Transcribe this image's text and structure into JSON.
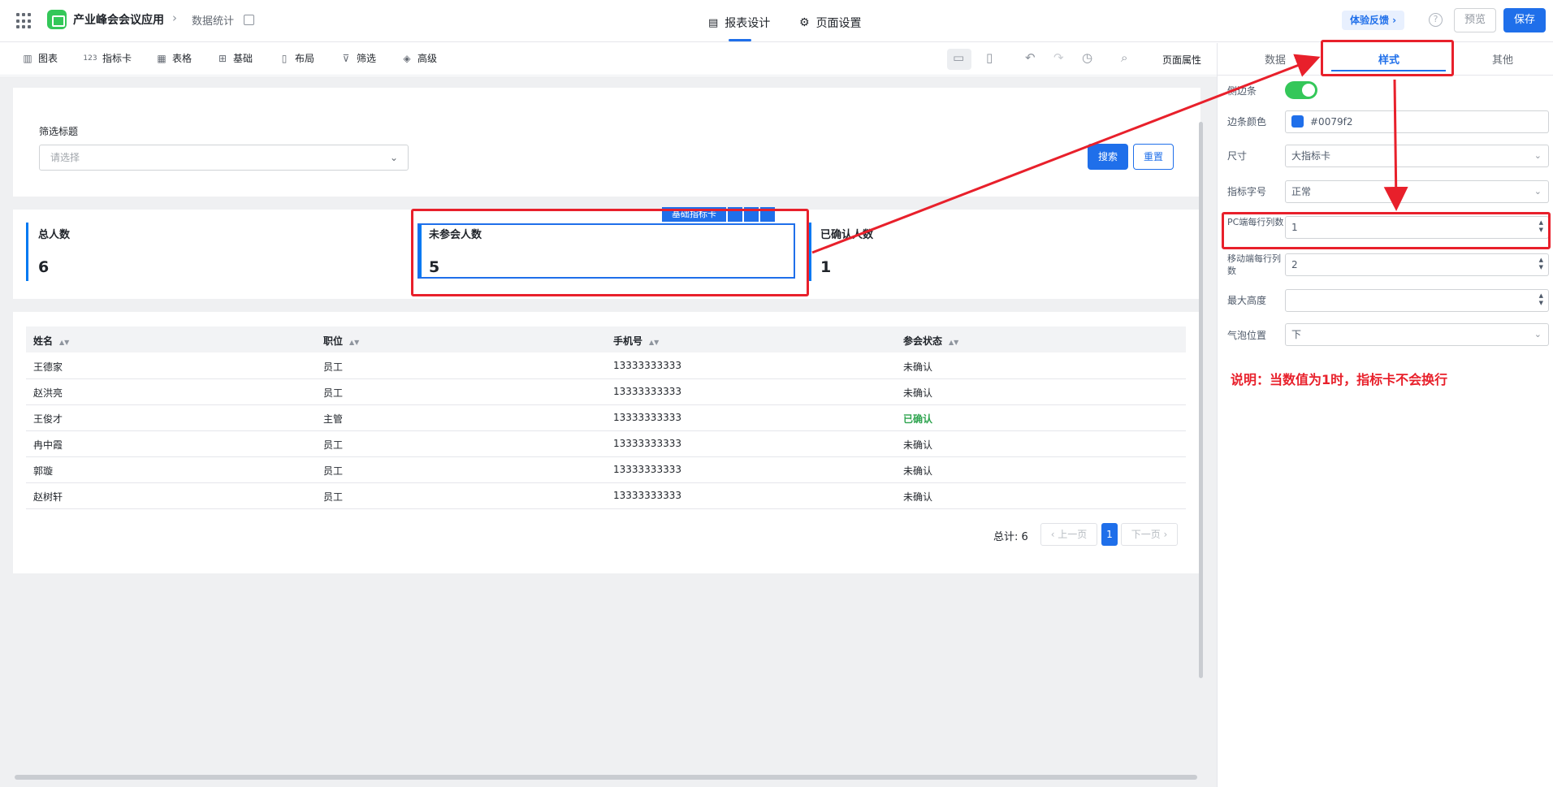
{
  "header": {
    "app_name": "产业峰会会议应用",
    "breadcrumb_sep": "›",
    "breadcrumb_page": "数据统计",
    "tabs": [
      {
        "label": "报表设计",
        "icon": "report-icon"
      },
      {
        "label": "页面设置",
        "icon": "gear-icon"
      }
    ],
    "feedback_label": "体验反馈 ›",
    "help_symbol": "?",
    "preview_label": "预览",
    "save_label": "保存"
  },
  "toolbar": {
    "items": [
      {
        "label": "图表",
        "icon": "bar-chart-icon"
      },
      {
        "label": "指标卡",
        "icon": "123-icon"
      },
      {
        "label": "表格",
        "icon": "table-icon"
      },
      {
        "label": "基础",
        "icon": "grid-icon"
      },
      {
        "label": "布局",
        "icon": "layout-icon"
      },
      {
        "label": "筛选",
        "icon": "filter-icon"
      },
      {
        "label": "高级",
        "icon": "layers-icon"
      }
    ],
    "page_props_label": "页面属性"
  },
  "filter": {
    "label": "筛选标题",
    "placeholder": "请选择",
    "search_label": "搜索",
    "reset_label": "重置"
  },
  "metrics": [
    {
      "title": "总人数",
      "value": "6"
    },
    {
      "title": "未参会人数",
      "value": "5"
    },
    {
      "title": "已确认人数",
      "value": "1"
    }
  ],
  "card_toolbar_label": "基础指标卡",
  "table": {
    "columns": [
      "姓名",
      "职位",
      "手机号",
      "参会状态"
    ],
    "rows": [
      [
        "王德家",
        "员工",
        "13333333333",
        "未确认"
      ],
      [
        "赵洪亮",
        "员工",
        "13333333333",
        "未确认"
      ],
      [
        "王俊才",
        "主管",
        "13333333333",
        "已确认"
      ],
      [
        "冉中霞",
        "员工",
        "13333333333",
        "未确认"
      ],
      [
        "郭璇",
        "员工",
        "13333333333",
        "未确认"
      ],
      [
        "赵树轩",
        "员工",
        "13333333333",
        "未确认"
      ]
    ],
    "total_label": "总计: 6",
    "prev_label": "‹ 上一页",
    "next_label": "下一页 ›",
    "current_page": "1"
  },
  "right_panel": {
    "tabs": [
      "数据",
      "样式",
      "其他"
    ],
    "active_tab": "样式",
    "props": {
      "sidebar_label": "侧边条",
      "sidebar_on": true,
      "border_color_label": "边条颜色",
      "border_color_value": "#0079f2",
      "size_label": "尺寸",
      "size_value": "大指标卡",
      "font_label": "指标字号",
      "font_value": "正常",
      "pc_cols_label": "PC端每行列数",
      "pc_cols_value": "1",
      "mobile_cols_label": "移动端每行列数",
      "mobile_cols_value": "2",
      "max_height_label": "最大高度",
      "max_height_value": "",
      "bubble_label": "气泡位置",
      "bubble_value": "下"
    },
    "note": "说明：当数值为1时，指标卡不会换行"
  },
  "colors": {
    "accent": "#1f6fea",
    "annotation": "#e8202b",
    "confirmed": "#2ea44f"
  }
}
